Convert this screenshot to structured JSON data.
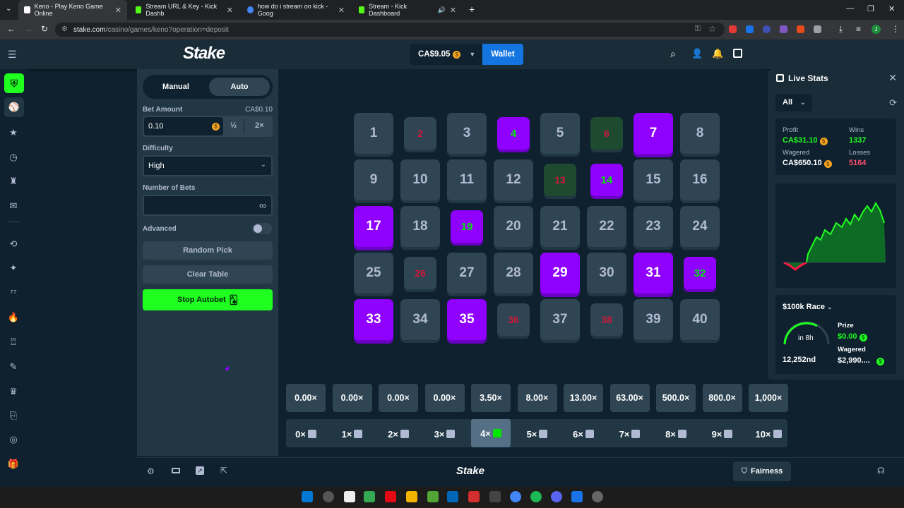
{
  "browser": {
    "tabs": [
      {
        "title": "Keno - Play Keno Game Online",
        "color": "#1a2c38"
      },
      {
        "title": "Stream URL & Key - Kick Dashb",
        "color": "#53fc18"
      },
      {
        "title": "how do i stream on kick - Goog",
        "color": "#4285f4"
      },
      {
        "title": "Stream - Kick Dashboard",
        "color": "#53fc18"
      }
    ],
    "url_host": "stake.com",
    "url_path": "/casino/games/keno?operation=deposit",
    "profile_initial": "J"
  },
  "header": {
    "logo": "Stake",
    "balance": "CA$9.05",
    "wallet_label": "Wallet"
  },
  "panel": {
    "tabs": {
      "manual": "Manual",
      "auto": "Auto"
    },
    "bet_amount_label": "Bet Amount",
    "bet_amount_fiat": "CA$0.10",
    "bet_amount_value": "0.10",
    "half_label": "½",
    "double_label": "2×",
    "difficulty_label": "Difficulty",
    "difficulty_value": "High",
    "number_of_bets_label": "Number of Bets",
    "infinity_symbol": "∞",
    "advanced_label": "Advanced",
    "random_pick_label": "Random Pick",
    "clear_table_label": "Clear Table",
    "stop_autobet_label": "Stop Autobet"
  },
  "board": {
    "tiles": [
      "1",
      "2",
      "3",
      "4",
      "5",
      "6",
      "7",
      "8",
      "9",
      "10",
      "11",
      "12",
      "13",
      "14",
      "15",
      "16",
      "17",
      "18",
      "19",
      "20",
      "21",
      "22",
      "23",
      "24",
      "25",
      "26",
      "27",
      "28",
      "29",
      "30",
      "31",
      "32",
      "33",
      "34",
      "35",
      "36",
      "37",
      "38",
      "39",
      "40"
    ],
    "multipliers": [
      "0.00×",
      "0.00×",
      "0.00×",
      "0.00×",
      "3.50×",
      "8.00×",
      "13.00×",
      "63.00×",
      "500.0×",
      "800.0×",
      "1,000×"
    ],
    "hit_counts": [
      "0×",
      "1×",
      "2×",
      "3×",
      "4×",
      "5×",
      "6×",
      "7×",
      "8×",
      "9×",
      "10×"
    ],
    "active_hit_index": 4
  },
  "live_stats": {
    "title": "Live Stats",
    "filter": "All",
    "profit_label": "Profit",
    "profit_value": "CA$31.10",
    "wins_label": "Wins",
    "wins_value": "1337",
    "wagered_label": "Wagered",
    "wagered_value": "CA$650.10",
    "losses_label": "Losses",
    "losses_value": "5164",
    "race_title": "$100k Race",
    "race_time": "in 8h",
    "race_rank": "12,252nd",
    "prize_label": "Prize",
    "prize_value": "$0.00",
    "race_wagered_label": "Wagered",
    "race_wagered_value": "$2,990....",
    "colors": {
      "win": "#1fff20",
      "loss": "#ff4d6d",
      "accent": "#9000ff"
    }
  },
  "footer": {
    "logo": "Stake",
    "fairness_label": "Fairness"
  }
}
